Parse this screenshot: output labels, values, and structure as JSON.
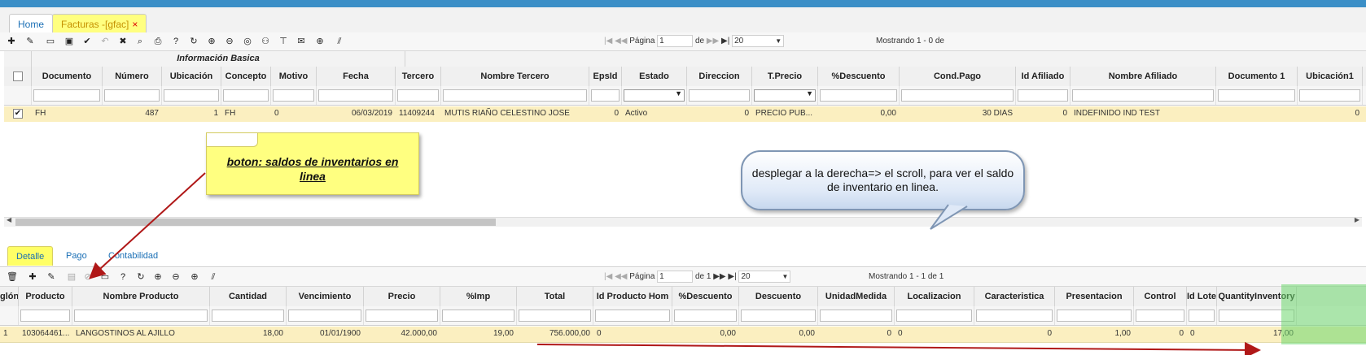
{
  "tabs": [
    {
      "label": "Home",
      "active": false
    },
    {
      "label": "Facturas -[gfac]",
      "active": true,
      "close": "×"
    }
  ],
  "top_toolbar": {
    "icons": [
      "add-icon",
      "edit-icon",
      "link-icon",
      "calendar-icon",
      "check-icon",
      "undo-icon",
      "delete-icon",
      "search-icon",
      "print-icon",
      "help-icon",
      "refresh-icon",
      "zoom-in-icon",
      "zoom-out-icon",
      "comment-icon",
      "user-icon",
      "pin-icon",
      "mail-icon",
      "plus-circle-icon",
      "resize-icon"
    ],
    "pager": {
      "first": "|◀",
      "prev": "◀◀",
      "page_label": "Página",
      "page_value": "1",
      "of_label": "de",
      "next": "▶▶",
      "last": "▶|",
      "page_size": "20"
    },
    "info": "Mostrando 1 - 0 de"
  },
  "master_grid": {
    "group_header": "Información Basica",
    "columns": [
      "Documento",
      "Número",
      "Ubicación",
      "Concepto",
      "Motivo",
      "Fecha",
      "Tercero",
      "Nombre Tercero",
      "EpsId",
      "Estado",
      "Direccion",
      "T.Precio",
      "%Descuento",
      "Cond.Pago",
      "Id Afiliado",
      "Nombre Afiliado",
      "Documento 1",
      "Ubicación1"
    ],
    "row": [
      "FH",
      "487",
      "1",
      "FH",
      "0",
      "06/03/2019",
      "11409244",
      "MUTIS RIAÑO CELESTINO JOSE",
      "0",
      "Activo",
      "0",
      "PRECIO PUB...",
      "0,00",
      "30 DIAS",
      "0",
      "INDEFINIDO IND TEST",
      "",
      "0"
    ],
    "checked": true
  },
  "callout_note": "boton: saldos de inventarios en linea",
  "speech_bubble": "desplegar a la derecha=> el scroll, para ver el saldo de inventario en linea.",
  "sub_tabs": [
    {
      "label": "Detalle",
      "active": true
    },
    {
      "label": "Pago",
      "active": false
    },
    {
      "label": "Contabilidad",
      "active": false
    }
  ],
  "detail_toolbar": {
    "pager": {
      "first": "|◀",
      "prev": "◀◀",
      "page_label": "Página",
      "page_value": "1",
      "of_label": "de 1",
      "next": "▶▶",
      "last": "▶|",
      "page_size": "20"
    },
    "info": "Mostrando 1 - 1 de 1"
  },
  "detail_grid": {
    "columns": [
      "glón",
      "Producto",
      "Nombre Producto",
      "Cantidad",
      "Vencimiento",
      "Precio",
      "%Imp",
      "Total",
      "Id Producto Hom",
      "%Descuento",
      "Descuento",
      "UnidadMedida",
      "Localizacion",
      "Caracteristica",
      "Presentacion",
      "Control",
      "Id Lote",
      "QuantityInventory"
    ],
    "row": [
      "1",
      "103064461...",
      "LANGOSTINOS AL AJILLO",
      "18,00",
      "01/01/1900",
      "42.000,00",
      "19,00",
      "756.000,00",
      "0",
      "0,00",
      "0,00",
      "0",
      "0",
      "0",
      "1,00",
      "0",
      "0",
      "17,00"
    ]
  },
  "colors": {
    "brand_bar": "#3b8fc7",
    "selected_row": "#fbefc0",
    "highlight": "#6ed76e",
    "annotation_arrow": "#b01818"
  }
}
